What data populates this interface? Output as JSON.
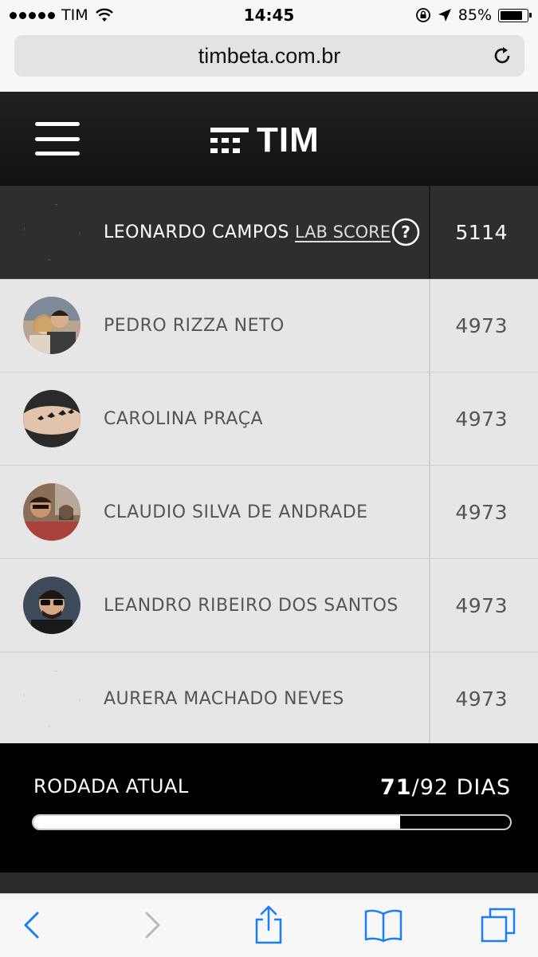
{
  "status_bar": {
    "carrier": "TIM",
    "time": "14:45",
    "battery": "85%",
    "battery_level": 0.85,
    "icons": [
      "signal-dots-icon",
      "wifi-icon",
      "rotation-lock-icon",
      "location-arrow-icon",
      "battery-icon"
    ]
  },
  "browser": {
    "url": "timbeta.com.br",
    "reload_icon": "reload-icon"
  },
  "header": {
    "menu_icon": "hamburger-icon",
    "logo_text": "TIM"
  },
  "ranking": {
    "lab_score_label": "LAB SCORE",
    "help_icon": "question-circle-icon",
    "rows": [
      {
        "name": "LEONARDO CAMPOS",
        "score": "5114",
        "highlight": true,
        "avatar": "blank"
      },
      {
        "name": "PEDRO RIZZA NETO",
        "score": "4973",
        "highlight": false,
        "avatar": "photo"
      },
      {
        "name": "CAROLINA PRAÇA",
        "score": "4973",
        "highlight": false,
        "avatar": "photo"
      },
      {
        "name": "CLAUDIO SILVA DE ANDRADE",
        "score": "4973",
        "highlight": false,
        "avatar": "photo"
      },
      {
        "name": "LEANDRO RIBEIRO DOS SANTOS",
        "score": "4973",
        "highlight": false,
        "avatar": "photo"
      },
      {
        "name": "AURERA MACHADO NEVES",
        "score": "4973",
        "highlight": false,
        "avatar": "blank"
      }
    ]
  },
  "round": {
    "label": "RODADA ATUAL",
    "current": "71",
    "total": "/92 DIAS",
    "progress": 0.77
  },
  "toolbar": {
    "icons": [
      "back-chevron-icon",
      "forward-chevron-icon",
      "share-icon",
      "bookmarks-icon",
      "tabs-icon"
    ]
  }
}
